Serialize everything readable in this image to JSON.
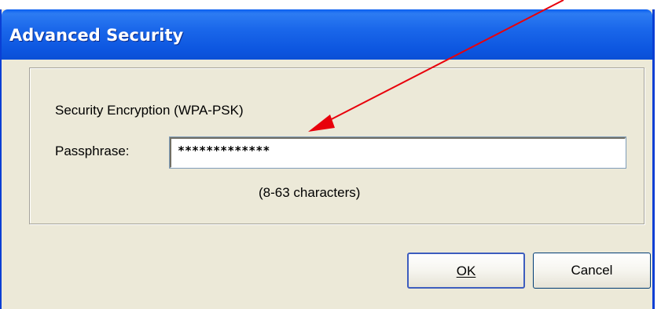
{
  "window": {
    "title": "Advanced Security"
  },
  "group": {
    "encryption_label": "Security Encryption (WPA-PSK)",
    "passphrase_label": "Passphrase:",
    "passphrase_value": "*************",
    "hint": "(8-63 characters)"
  },
  "buttons": {
    "ok_label": "OK",
    "cancel_label": "Cancel"
  },
  "annotation": {
    "arrow_color": "#e8000b"
  },
  "colors": {
    "titlebar": "#0a5ef0",
    "dialog_background": "#ece9d8"
  }
}
